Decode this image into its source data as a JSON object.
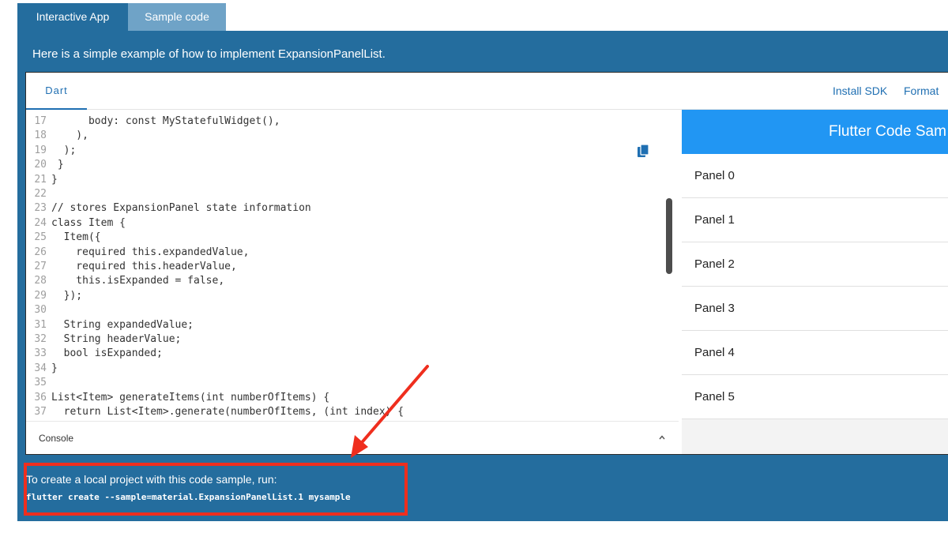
{
  "tabs": {
    "interactive": "Interactive App",
    "sample": "Sample code"
  },
  "intro": "Here is a simple example of how to implement ExpansionPanelList.",
  "pad": {
    "dart_tab": "Dart",
    "install_sdk": "Install SDK",
    "format": "Format",
    "console_label": "Console"
  },
  "code": [
    {
      "n": "17",
      "text": "      body: const MyStatefulWidget(),"
    },
    {
      "n": "18",
      "text": "    ),"
    },
    {
      "n": "19",
      "text": "  );"
    },
    {
      "n": "20",
      "text": " }"
    },
    {
      "n": "21",
      "text": "}"
    },
    {
      "n": "22",
      "text": ""
    },
    {
      "n": "23",
      "text": "// stores ExpansionPanel state information"
    },
    {
      "n": "24",
      "text": "class Item {"
    },
    {
      "n": "25",
      "text": "  Item({"
    },
    {
      "n": "26",
      "text": "    required this.expandedValue,"
    },
    {
      "n": "27",
      "text": "    required this.headerValue,"
    },
    {
      "n": "28",
      "text": "    this.isExpanded = false,"
    },
    {
      "n": "29",
      "text": "  });"
    },
    {
      "n": "30",
      "text": ""
    },
    {
      "n": "31",
      "text": "  String expandedValue;"
    },
    {
      "n": "32",
      "text": "  String headerValue;"
    },
    {
      "n": "33",
      "text": "  bool isExpanded;"
    },
    {
      "n": "34",
      "text": "}"
    },
    {
      "n": "35",
      "text": ""
    },
    {
      "n": "36",
      "text": "List<Item> generateItems(int numberOfItems) {"
    },
    {
      "n": "37",
      "text": "  return List<Item>.generate(numberOfItems, (int index) {"
    }
  ],
  "preview": {
    "title": "Flutter Code Sam",
    "panels": [
      "Panel 0",
      "Panel 1",
      "Panel 2",
      "Panel 3",
      "Panel 4",
      "Panel 5"
    ]
  },
  "command": {
    "label": "To create a local project with this code sample, run:",
    "code": "flutter create --sample=material.ExpansionPanelList.1 mysample"
  },
  "colors": {
    "frame": "#246d9e",
    "tab_inactive": "#6fa3c7",
    "appbar": "#2196f3",
    "highlight": "#ef2e1e"
  }
}
